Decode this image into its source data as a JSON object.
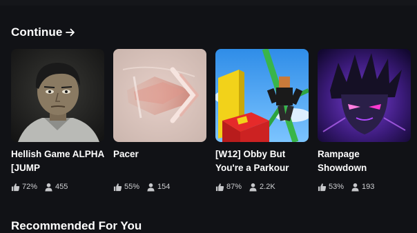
{
  "section": {
    "title": "Continue",
    "arrow_icon": "arrow-right-icon"
  },
  "games": [
    {
      "title": "Hellish Game ALPHA [JUMP",
      "like_ratio": "72%",
      "players": "455",
      "thumbnail": "hellish-game-thumbnail"
    },
    {
      "title": "Pacer",
      "like_ratio": "55%",
      "players": "154",
      "thumbnail": "pacer-thumbnail"
    },
    {
      "title": "[W12] Obby But You're a Parkour",
      "like_ratio": "87%",
      "players": "2.2K",
      "thumbnail": "obby-parkour-thumbnail"
    },
    {
      "title": "Rampage Showdown",
      "like_ratio": "53%",
      "players": "193",
      "thumbnail": "rampage-showdown-thumbnail"
    }
  ],
  "next_section": {
    "title": "Recommended For You"
  },
  "colors": {
    "background": "#111216",
    "text": "#ffffff",
    "stat_text": "#d0d1d4"
  }
}
